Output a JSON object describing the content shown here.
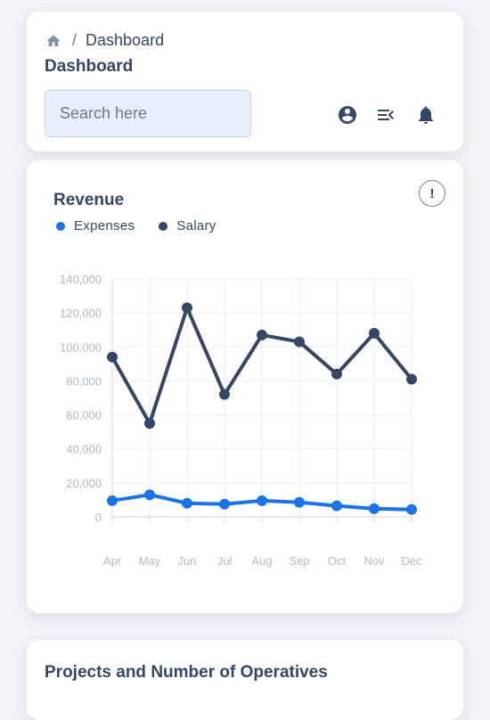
{
  "breadcrumb": {
    "current": "Dashboard",
    "separator": "/"
  },
  "header": {
    "title": "Dashboard"
  },
  "search": {
    "placeholder": "Search here"
  },
  "icons": {
    "account": "account-circle-icon",
    "menu": "menu-open-icon",
    "notifications": "bell-icon",
    "home": "home-icon",
    "info": "info-icon"
  },
  "revenue": {
    "title": "Revenue",
    "info_symbol": "!",
    "legend": [
      {
        "label": "Expenses",
        "color": "#1a73e8"
      },
      {
        "label": "Salary",
        "color": "#344767"
      }
    ]
  },
  "chart_data": {
    "type": "line",
    "categories": [
      "Apr",
      "May",
      "Jun",
      "Jul",
      "Aug",
      "Sep",
      "Oct",
      "Nov",
      "Dec"
    ],
    "series": [
      {
        "name": "Expenses",
        "color": "#1a73e8",
        "values": [
          9500,
          13000,
          8000,
          7500,
          9500,
          8500,
          6500,
          4800,
          4300
        ]
      },
      {
        "name": "Salary",
        "color": "#344767",
        "values": [
          94000,
          55000,
          123000,
          72000,
          107000,
          103000,
          84000,
          108000,
          81000
        ]
      }
    ],
    "ylim": [
      0,
      140000
    ],
    "yticks": [
      0,
      20000,
      40000,
      60000,
      80000,
      100000,
      120000,
      140000
    ],
    "ytick_labels": [
      "0",
      "20,000",
      "40,000",
      "60,000",
      "80,000",
      "100,000",
      "120,000",
      "140,000"
    ],
    "grid": true,
    "legend_placement": "top-left",
    "title": "Revenue",
    "xlabel": "",
    "ylabel": ""
  },
  "projects": {
    "title": "Projects and Number of Operatives"
  }
}
